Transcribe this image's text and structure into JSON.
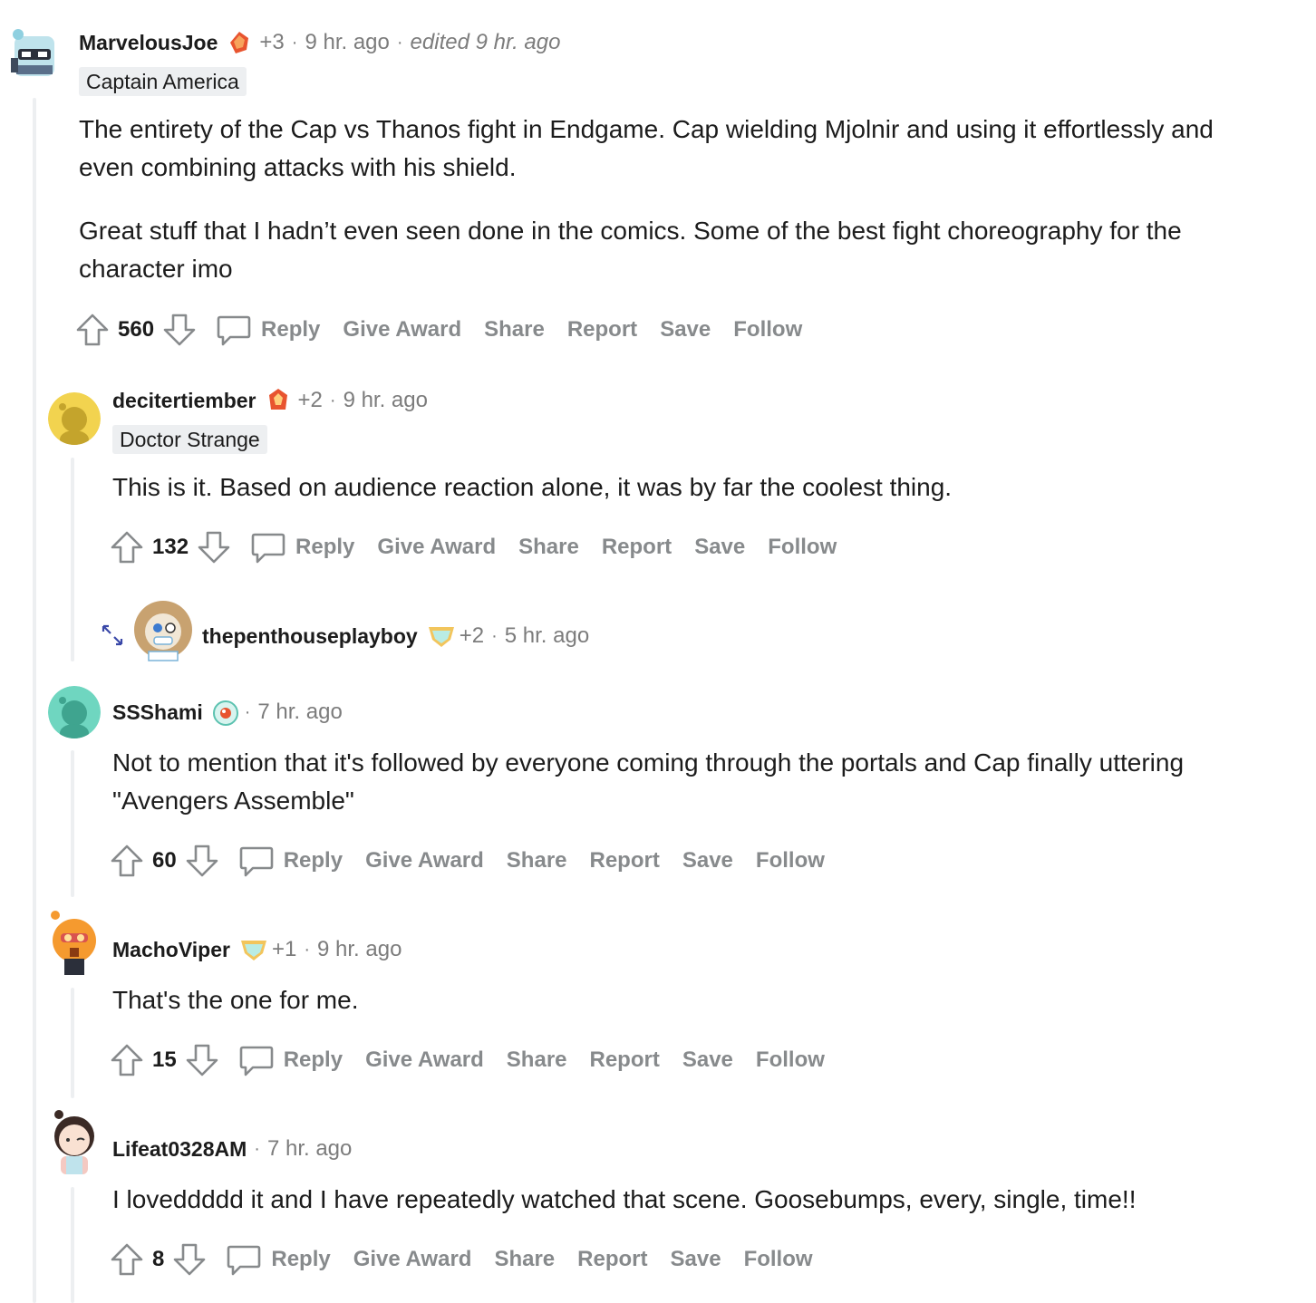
{
  "comments": [
    {
      "username": "MarvelousJoe",
      "award_count": "+3",
      "time": "9 hr. ago",
      "edited": "edited 9 hr. ago",
      "flair": "Captain America",
      "paragraphs": [
        "The entirety of the Cap vs Thanos fight in Endgame. Cap wielding Mjolnir and using it effortlessly and even combining attacks with his shield.",
        "Great stuff that I hadn’t even seen done in the comics. Some of the best fight choreography for the character imo"
      ],
      "score": "560",
      "avatar_color": "#a9d3e0"
    },
    {
      "username": "decitertiember",
      "award_count": "+2",
      "time": "9 hr. ago",
      "flair": "Doctor Strange",
      "paragraphs": [
        "This is it. Based on audience reaction alone, it was by far the coolest thing."
      ],
      "score": "132",
      "avatar_color": "#f2d34f"
    },
    {
      "username": "thepenthouseplayboy",
      "award_count": "+2",
      "time": "5 hr. ago",
      "collapsed": true,
      "avatar_color": "#c8a270"
    },
    {
      "username": "SSShami",
      "time": "7 hr. ago",
      "paragraphs": [
        "Not to mention that it's followed by everyone coming through the portals and Cap finally uttering \"Avengers Assemble\""
      ],
      "score": "60",
      "avatar_color": "#6fd6c0"
    },
    {
      "username": "MachoViper",
      "award_count": "+1",
      "time": "9 hr. ago",
      "paragraphs": [
        "That's the one for me."
      ],
      "score": "15",
      "avatar_color": "#f59a2f"
    },
    {
      "username": "Lifeat0328AM",
      "time": "7 hr. ago",
      "paragraphs": [
        "I loveddddd it and I have repeatedly watched that scene. Goosebumps, every, single, time!!"
      ],
      "score": "8",
      "avatar_color": "#f4c9c2"
    }
  ],
  "actions": {
    "reply": "Reply",
    "give_award": "Give Award",
    "share": "Share",
    "report": "Report",
    "save": "Save",
    "follow": "Follow"
  },
  "separator": "·",
  "colors": {
    "text": "#1c1c1c",
    "meta": "#7c7c7c",
    "action": "#878a8c",
    "thread_line": "#edeff1",
    "flair_bg": "#edeff1"
  },
  "icons": [
    "upvote-icon",
    "downvote-icon",
    "comment-icon",
    "award-icon",
    "expand-icon",
    "avatar"
  ]
}
